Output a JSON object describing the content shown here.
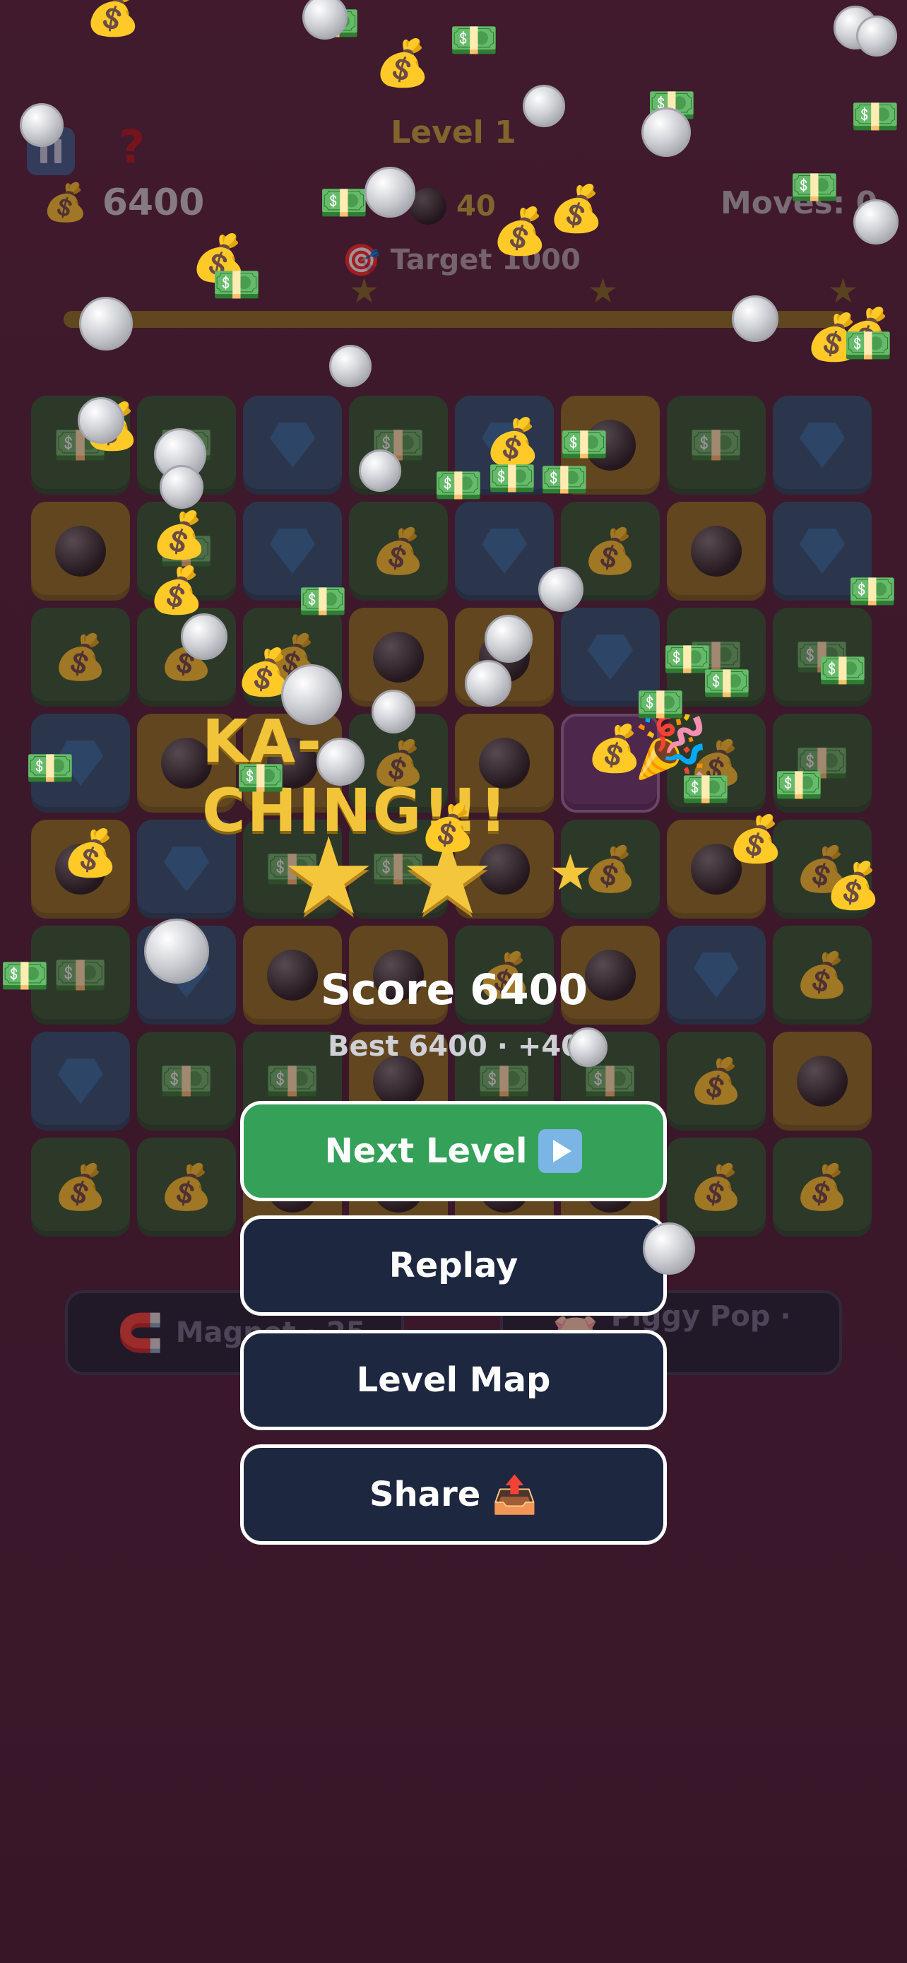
{
  "hud": {
    "level": "Level 1",
    "coins": "6400",
    "help_glyph": "?",
    "gem_count": "40",
    "moves": "Moves: 0",
    "target": "Target 1000",
    "progress_fraction": 1.0
  },
  "board": {
    "rows": [
      [
        "bill",
        "bill",
        "diamond",
        "bill",
        "diamond",
        "ball",
        "bill",
        "diamond"
      ],
      [
        "ball",
        "bill",
        "diamond",
        "bag",
        "diamond",
        "bag",
        "ball",
        "diamond"
      ],
      [
        "bag",
        "bag",
        "bag",
        "ball",
        "ball",
        "diamond",
        "bill",
        "bill"
      ],
      [
        "diamond",
        "ball",
        "ball",
        "bag",
        "ball",
        "selected",
        "bag",
        "bill"
      ],
      [
        "ball",
        "diamond",
        "bill",
        "bill",
        "ball",
        "bag",
        "ball",
        "bag"
      ],
      [
        "bill",
        "diamond",
        "ball",
        "ball",
        "bag",
        "ball",
        "diamond",
        "bag"
      ],
      [
        "diamond",
        "bill",
        "bill",
        "ball",
        "bill",
        "bill",
        "bag",
        "ball"
      ],
      [
        "bag",
        "bag",
        "ball",
        "ball",
        "ball",
        "ball",
        "bag",
        "bag"
      ]
    ],
    "tile_glyphs": {
      "bill": "💵",
      "bag": "💰"
    }
  },
  "boosters": [
    {
      "label": "Magnet · 25",
      "icon": "🧲"
    },
    {
      "label": "Piggy Pop · 25",
      "icon": "🐷"
    }
  ],
  "overlay": {
    "headline": "KA-CHING!!!",
    "party_icon": "🎉",
    "stars_earned": 3,
    "score": "Score 6400",
    "best_line": "Best 6400  ·  +40",
    "buttons": {
      "next": "Next Level",
      "replay": "Replay",
      "map": "Level Map",
      "share": "Share",
      "share_icon": "📤"
    }
  },
  "particles": {
    "bill": "💵",
    "bag": "💰"
  },
  "colors": {
    "accent_green": "#34a058",
    "button_navy": "#1e2740",
    "headline_gold": "#f1c43a"
  }
}
